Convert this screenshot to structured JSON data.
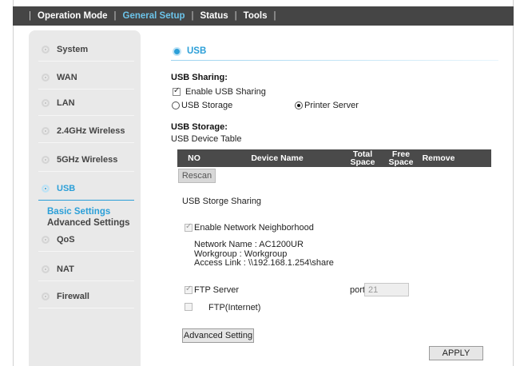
{
  "topnav": {
    "items": [
      "Operation Mode",
      "General Setup",
      "Status",
      "Tools"
    ],
    "active": "General Setup"
  },
  "sidebar": {
    "items": [
      {
        "label": "System"
      },
      {
        "label": "WAN"
      },
      {
        "label": "LAN"
      },
      {
        "label": "2.4GHz Wireless"
      },
      {
        "label": "5GHz Wireless"
      },
      {
        "label": "USB"
      },
      {
        "label": "QoS"
      },
      {
        "label": "NAT"
      },
      {
        "label": "Firewall"
      }
    ],
    "sub_items": [
      "Basic Settings",
      "Advanced Settings"
    ]
  },
  "section": {
    "title": "USB"
  },
  "usb_sharing": {
    "heading": "USB Sharing:",
    "enable_label": "Enable USB Sharing",
    "enable_checked": true,
    "storage_label": "USB Storage",
    "printer_label": "Printer Server",
    "selected": "Printer Server"
  },
  "usb_storage": {
    "heading": "USB Storage:",
    "table_title": "USB Device Table",
    "columns": [
      "NO",
      "Device Name",
      "Total Space",
      "Free Space",
      "Remove"
    ],
    "rescan_label": "Rescan"
  },
  "storage_sharing": {
    "title": "USB Storge Sharing",
    "network_neighborhood_label": "Enable Network Neighborhood",
    "network_name": "Network Name : AC1200UR",
    "workgroup": "Workgroup : Workgroup",
    "access_link": "Access Link : \\\\192.168.1.254\\share",
    "ftp_server_label": "FTP Server",
    "port_label": "port",
    "port_value": "21",
    "ftp_internet_label": "FTP(Internet)",
    "advanced_button": "Advanced Setting",
    "apply_button": "APPLY"
  },
  "colors": {
    "accent": "#2b9fd8",
    "nav_bg": "#454545",
    "sidebar_bg": "#e9e9e9",
    "table_header_bg": "#4a4a4a"
  }
}
